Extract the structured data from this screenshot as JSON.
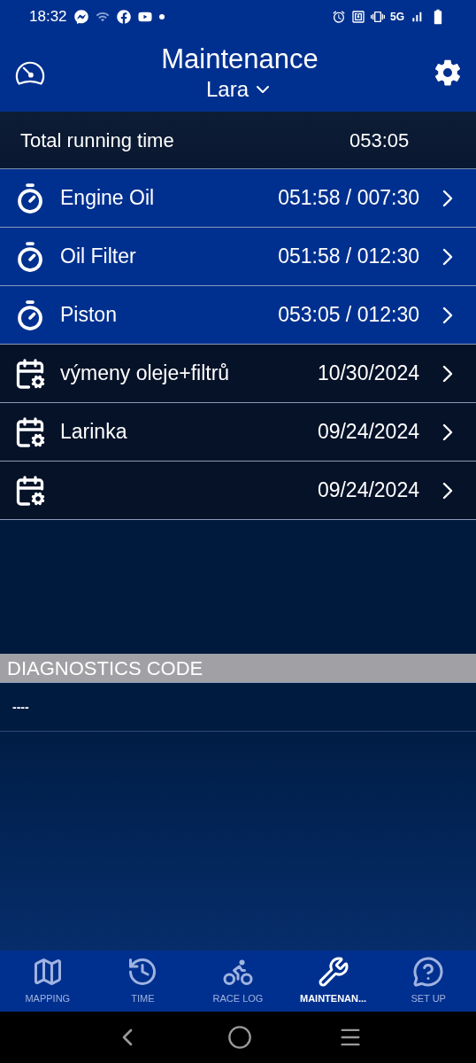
{
  "status_bar": {
    "time": "18:32",
    "network": "5G"
  },
  "header": {
    "title": "Maintenance",
    "profile": "Lara"
  },
  "total": {
    "label": "Total running time",
    "value": "053:05"
  },
  "items": [
    {
      "kind": "timer",
      "name": "Engine Oil",
      "value": "051:58 / 007:30"
    },
    {
      "kind": "timer",
      "name": "Oil Filter",
      "value": "051:58 / 012:30"
    },
    {
      "kind": "timer",
      "name": "Piston",
      "value": "053:05 / 012:30"
    },
    {
      "kind": "calendar",
      "name": "výmeny oleje+filtrů",
      "value": "10/30/2024"
    },
    {
      "kind": "calendar",
      "name": "Larinka",
      "value": "09/24/2024"
    },
    {
      "kind": "calendar",
      "value": "09/24/2024"
    }
  ],
  "diagnostics": {
    "title": "DIAGNOSTICS CODE",
    "code": "----"
  },
  "nav": [
    {
      "kind": "map",
      "label": "MAPPING",
      "selected": false
    },
    {
      "kind": "time",
      "label": "TIME",
      "selected": false
    },
    {
      "kind": "racelog",
      "label": "RACE LOG",
      "selected": false
    },
    {
      "kind": "tools",
      "label": "MAINTENAN...",
      "selected": true
    },
    {
      "kind": "help",
      "label": "SET UP",
      "selected": false
    }
  ]
}
